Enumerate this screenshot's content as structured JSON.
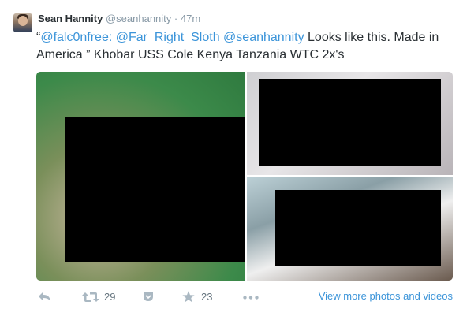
{
  "tweet": {
    "fullname": "Sean Hannity",
    "username": "@seanhannity",
    "separator": "·",
    "time": "47m",
    "text_prefix": "“",
    "mentions": [
      "@falc0nfree:",
      "@Far_Right_Sloth",
      "@seanhannity"
    ],
    "text_body": " Looks like this. Made in America ” Khobar USS Cole Kenya Tanzania WTC 2x's"
  },
  "actions": {
    "reply_icon": "reply-icon",
    "retweet_icon": "retweet-icon",
    "retweet_count": "29",
    "favorite_icon": "bookmark-icon",
    "star_icon": "star-icon",
    "favorite_count": "23",
    "more_icon": "more-icon",
    "view_more": "View more photos and videos"
  },
  "colors": {
    "link": "#3b94d9",
    "name": "#292f33",
    "muted": "#8899a6",
    "redaction": "#000000"
  }
}
